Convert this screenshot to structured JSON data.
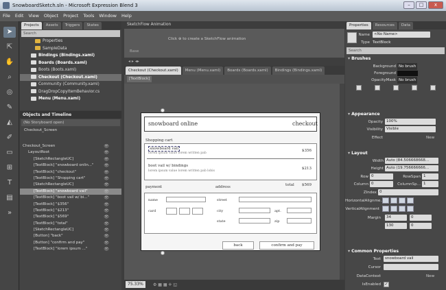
{
  "window": {
    "title": "SnowboardSketch.sln - Microsoft Expression Blend 3",
    "min": "–",
    "max": "□",
    "close": "x"
  },
  "menu": [
    "File",
    "Edit",
    "View",
    "Object",
    "Project",
    "Tools",
    "Window",
    "Help"
  ],
  "project": {
    "tabs": [
      "Projects",
      "Assets",
      "Triggers",
      "States"
    ],
    "search_placeholder": "Search",
    "items": [
      {
        "label": "Properties",
        "kind": "folder"
      },
      {
        "label": "SampleData",
        "kind": "folder"
      },
      {
        "label": "Bindings (Bindings.xaml)",
        "kind": "xaml",
        "bold": true
      },
      {
        "label": "Boards (Boards.xaml)",
        "kind": "xaml",
        "bold": true
      },
      {
        "label": "Boots (Boots.xaml)",
        "kind": "xaml"
      },
      {
        "label": "Checkout (Checkout.xaml)",
        "kind": "xaml",
        "bold": true,
        "selected": true
      },
      {
        "label": "Community (Community.xaml)",
        "kind": "xaml"
      },
      {
        "label": "DragDropCopyItemBehavior.cs",
        "kind": "cs"
      },
      {
        "label": "Menu (Menu.xaml)",
        "kind": "xaml",
        "bold": true
      }
    ]
  },
  "objects": {
    "title": "Objects and Timeline",
    "storyboard": "(No Storyboard open)",
    "root": "Checkout_Screen",
    "rows": [
      {
        "label": "Checkout_Screen",
        "indent": 0
      },
      {
        "label": "LayoutRoot",
        "indent": 1
      },
      {
        "label": "[SketchRectangleUC]",
        "indent": 2
      },
      {
        "label": "[TextBlock] \"snowboard onlin...\"",
        "indent": 2
      },
      {
        "label": "[TextBlock] \"checkout\"",
        "indent": 2
      },
      {
        "label": "[TextBlock] \"Shopping cart\"",
        "indent": 2
      },
      {
        "label": "[SketchRectangleUC]",
        "indent": 2
      },
      {
        "label": "[TextBlock] \"snowboard vail\"",
        "indent": 2,
        "selected": true
      },
      {
        "label": "[TextBlock] \"boot vail w/ bi...\"",
        "indent": 2
      },
      {
        "label": "[TextBlock] \"$356\"",
        "indent": 2
      },
      {
        "label": "[TextBlock] \"$213\"",
        "indent": 2
      },
      {
        "label": "[TextBlock] \"$569\"",
        "indent": 2
      },
      {
        "label": "[TextBlock] \"total\"",
        "indent": 2
      },
      {
        "label": "[SketchRectangleUC]",
        "indent": 2
      },
      {
        "label": "[Button] \"back\"",
        "indent": 2
      },
      {
        "label": "[Button] \"confirm and pay\"",
        "indent": 2
      },
      {
        "label": "[TextBlock] \"lorem ipsum ...\"",
        "indent": 2
      }
    ]
  },
  "animation": {
    "title": "SketchFlow Animation",
    "hint": "Click ⊕ to create a SketchFlow animation",
    "base": "Base"
  },
  "doc_tabs": [
    "Checkout (Checkout.xaml)",
    "Menu (Menu.xaml)",
    "Boards (Boards.xaml)",
    "Bindings (Bindings.xaml)"
  ],
  "breadcrumb": "[TextBlock]",
  "sketch": {
    "brand": "snowboard online",
    "checkout": "checkout",
    "cart": "Shopping cart",
    "item1": "snowboard vail",
    "item1_desc": "lorem ipsum value lorem written pab",
    "price1": "$356",
    "item2": "boot vail w/ bindings",
    "item2_desc": "lorem ipsum value lorem written pab lobis",
    "price2": "$213",
    "total_label": "total",
    "total": "$569",
    "payment": "payment",
    "address": "address",
    "name": "name",
    "card": "card",
    "street": "street",
    "city": "city",
    "state": "state",
    "apt": "apt.",
    "zip": "zip",
    "back": "back",
    "confirm": "confirm and pay"
  },
  "zoom": "75.33%",
  "props": {
    "tabs": [
      "Properties",
      "Resources",
      "Data"
    ],
    "name_label": "Name",
    "name_value": "<No Name>",
    "type_label": "Type",
    "type_value": "TextBlock",
    "search": "Search",
    "brushes": "Brushes",
    "background": "Background",
    "background_val": "No brush",
    "foreground": "Foreground",
    "opacitymask": "OpacityMask",
    "opacitymask_val": "No brush",
    "appearance": "Appearance",
    "opacity": "Opacity",
    "opacity_val": "100%",
    "visibility": "Visibility",
    "visibility_val": "Visible",
    "effect": "Effect",
    "new": "New",
    "layout": "Layout",
    "width": "Width",
    "width_val": "Auto (84.506668668...",
    "height": "Height",
    "height_val": "Auto (19.756666666...",
    "row": "Row",
    "row_val": "0",
    "rowspan": "RowSpan",
    "rowspan_val": "1",
    "column": "Column",
    "column_val": "0",
    "columnspan": "ColumnSp...",
    "columnspan_val": "1",
    "zindex": "ZIndex",
    "zindex_val": "0",
    "halign": "HorizontalAlignme...",
    "valign": "VerticalAlignment",
    "margin": "Margin",
    "m_left": "34",
    "m_right": "0",
    "m_top": "130",
    "m_bottom": "0",
    "common": "Common Properties",
    "text": "Text",
    "text_val": "snowboard vail",
    "cursor": "Cursor",
    "datacontext": "DataContext",
    "isenabled": "IsEnabled"
  }
}
